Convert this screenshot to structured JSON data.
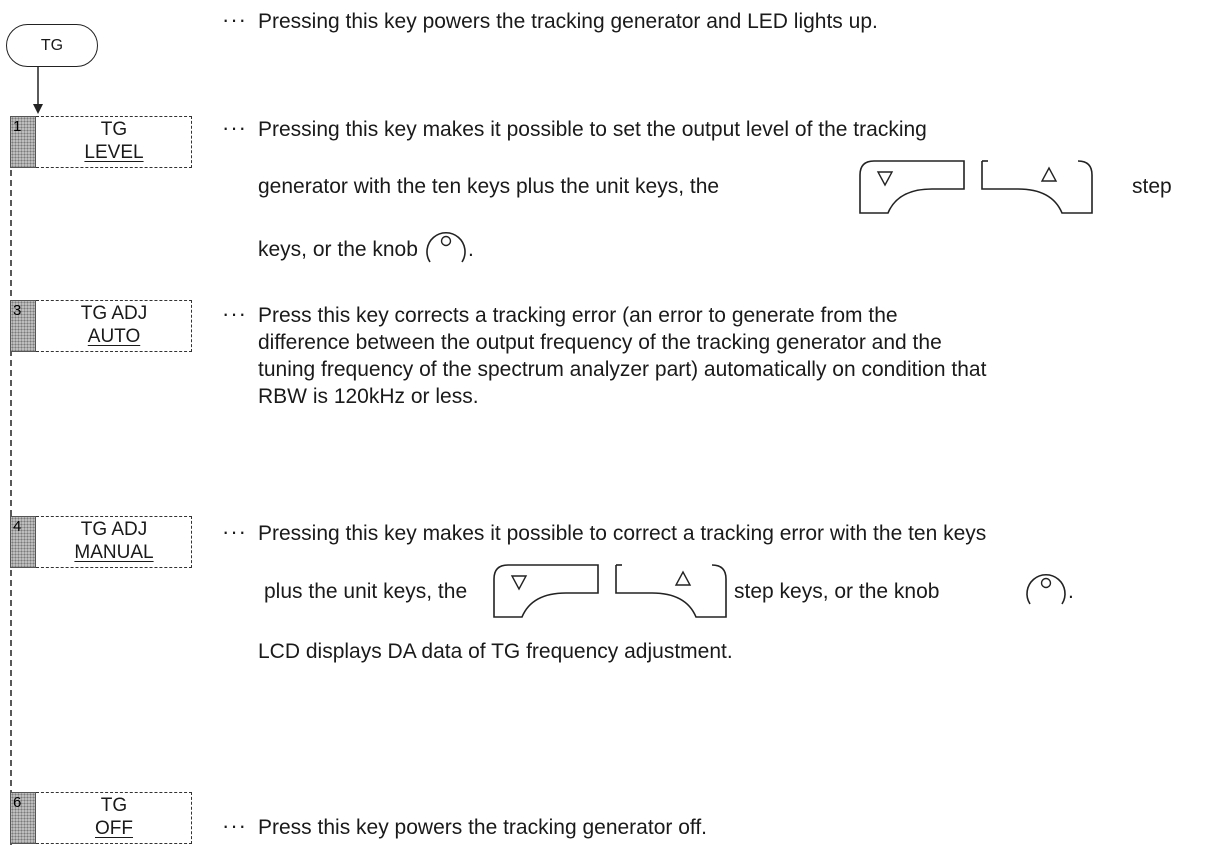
{
  "tg_key": {
    "label": "TG"
  },
  "ellipsis": "···",
  "items": [
    {
      "key_number": "1",
      "key_line1": "TG",
      "key_line2": "LEVEL",
      "desc_lines": [
        "Pressing this key makes it possible to set the output level of the tracking",
        "generator with the ten keys plus the unit keys, the",
        "step",
        "keys, or the knob",
        "."
      ]
    },
    {
      "key_number": "3",
      "key_line1": "TG ADJ",
      "key_line2": "AUTO",
      "desc_lines": [
        "Press this key corrects a tracking error (an error to generate from the",
        "difference between the output frequency of the tracking generator and the",
        "tuning frequency of the spectrum analyzer part) automatically on condition that",
        "RBW is 120kHz or less."
      ]
    },
    {
      "key_number": "4",
      "key_line1": "TG ADJ",
      "key_line2": "MANUAL",
      "desc_lines": [
        "Pressing this key makes it possible to correct a tracking error with the ten keys",
        "plus the unit keys, the",
        "step keys, or the knob",
        ".",
        "LCD displays DA data of TG frequency adjustment."
      ]
    },
    {
      "key_number": "6",
      "key_line1": "TG",
      "key_line2": "OFF",
      "desc_lines": [
        "Press this key powers the tracking generator off."
      ]
    }
  ],
  "tg_desc": "Pressing this key powers the tracking generator and LED lights up.",
  "icons": {
    "step_down": "step-down-key-icon",
    "step_up": "step-up-key-icon",
    "knob": "knob-icon"
  }
}
